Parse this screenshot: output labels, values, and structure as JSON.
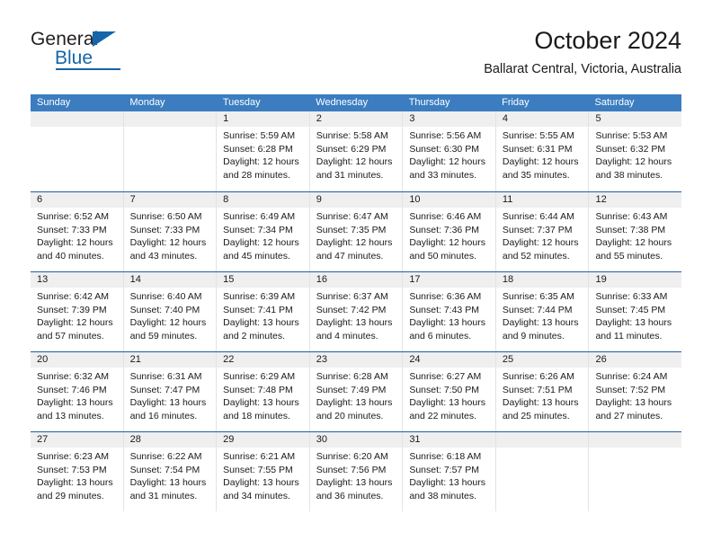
{
  "logo": {
    "word_one": "General",
    "word_two": "Blue",
    "triangle_icon": "triangle-icon",
    "accent_color": "#1565a8"
  },
  "header": {
    "title": "October 2024",
    "subtitle": "Ballarat Central, Victoria, Australia"
  },
  "calendar": {
    "header_bg": "#3b7dc0",
    "header_text_color": "#ffffff",
    "row_divider_color": "#1f5fa6",
    "date_strip_bg": "#efefef",
    "weekdays": [
      "Sunday",
      "Monday",
      "Tuesday",
      "Wednesday",
      "Thursday",
      "Friday",
      "Saturday"
    ],
    "weeks": [
      [
        {
          "date": "",
          "lines": []
        },
        {
          "date": "",
          "lines": []
        },
        {
          "date": "1",
          "lines": [
            "Sunrise: 5:59 AM",
            "Sunset: 6:28 PM",
            "Daylight: 12 hours",
            "and 28 minutes."
          ]
        },
        {
          "date": "2",
          "lines": [
            "Sunrise: 5:58 AM",
            "Sunset: 6:29 PM",
            "Daylight: 12 hours",
            "and 31 minutes."
          ]
        },
        {
          "date": "3",
          "lines": [
            "Sunrise: 5:56 AM",
            "Sunset: 6:30 PM",
            "Daylight: 12 hours",
            "and 33 minutes."
          ]
        },
        {
          "date": "4",
          "lines": [
            "Sunrise: 5:55 AM",
            "Sunset: 6:31 PM",
            "Daylight: 12 hours",
            "and 35 minutes."
          ]
        },
        {
          "date": "5",
          "lines": [
            "Sunrise: 5:53 AM",
            "Sunset: 6:32 PM",
            "Daylight: 12 hours",
            "and 38 minutes."
          ]
        }
      ],
      [
        {
          "date": "6",
          "lines": [
            "Sunrise: 6:52 AM",
            "Sunset: 7:33 PM",
            "Daylight: 12 hours",
            "and 40 minutes."
          ]
        },
        {
          "date": "7",
          "lines": [
            "Sunrise: 6:50 AM",
            "Sunset: 7:33 PM",
            "Daylight: 12 hours",
            "and 43 minutes."
          ]
        },
        {
          "date": "8",
          "lines": [
            "Sunrise: 6:49 AM",
            "Sunset: 7:34 PM",
            "Daylight: 12 hours",
            "and 45 minutes."
          ]
        },
        {
          "date": "9",
          "lines": [
            "Sunrise: 6:47 AM",
            "Sunset: 7:35 PM",
            "Daylight: 12 hours",
            "and 47 minutes."
          ]
        },
        {
          "date": "10",
          "lines": [
            "Sunrise: 6:46 AM",
            "Sunset: 7:36 PM",
            "Daylight: 12 hours",
            "and 50 minutes."
          ]
        },
        {
          "date": "11",
          "lines": [
            "Sunrise: 6:44 AM",
            "Sunset: 7:37 PM",
            "Daylight: 12 hours",
            "and 52 minutes."
          ]
        },
        {
          "date": "12",
          "lines": [
            "Sunrise: 6:43 AM",
            "Sunset: 7:38 PM",
            "Daylight: 12 hours",
            "and 55 minutes."
          ]
        }
      ],
      [
        {
          "date": "13",
          "lines": [
            "Sunrise: 6:42 AM",
            "Sunset: 7:39 PM",
            "Daylight: 12 hours",
            "and 57 minutes."
          ]
        },
        {
          "date": "14",
          "lines": [
            "Sunrise: 6:40 AM",
            "Sunset: 7:40 PM",
            "Daylight: 12 hours",
            "and 59 minutes."
          ]
        },
        {
          "date": "15",
          "lines": [
            "Sunrise: 6:39 AM",
            "Sunset: 7:41 PM",
            "Daylight: 13 hours",
            "and 2 minutes."
          ]
        },
        {
          "date": "16",
          "lines": [
            "Sunrise: 6:37 AM",
            "Sunset: 7:42 PM",
            "Daylight: 13 hours",
            "and 4 minutes."
          ]
        },
        {
          "date": "17",
          "lines": [
            "Sunrise: 6:36 AM",
            "Sunset: 7:43 PM",
            "Daylight: 13 hours",
            "and 6 minutes."
          ]
        },
        {
          "date": "18",
          "lines": [
            "Sunrise: 6:35 AM",
            "Sunset: 7:44 PM",
            "Daylight: 13 hours",
            "and 9 minutes."
          ]
        },
        {
          "date": "19",
          "lines": [
            "Sunrise: 6:33 AM",
            "Sunset: 7:45 PM",
            "Daylight: 13 hours",
            "and 11 minutes."
          ]
        }
      ],
      [
        {
          "date": "20",
          "lines": [
            "Sunrise: 6:32 AM",
            "Sunset: 7:46 PM",
            "Daylight: 13 hours",
            "and 13 minutes."
          ]
        },
        {
          "date": "21",
          "lines": [
            "Sunrise: 6:31 AM",
            "Sunset: 7:47 PM",
            "Daylight: 13 hours",
            "and 16 minutes."
          ]
        },
        {
          "date": "22",
          "lines": [
            "Sunrise: 6:29 AM",
            "Sunset: 7:48 PM",
            "Daylight: 13 hours",
            "and 18 minutes."
          ]
        },
        {
          "date": "23",
          "lines": [
            "Sunrise: 6:28 AM",
            "Sunset: 7:49 PM",
            "Daylight: 13 hours",
            "and 20 minutes."
          ]
        },
        {
          "date": "24",
          "lines": [
            "Sunrise: 6:27 AM",
            "Sunset: 7:50 PM",
            "Daylight: 13 hours",
            "and 22 minutes."
          ]
        },
        {
          "date": "25",
          "lines": [
            "Sunrise: 6:26 AM",
            "Sunset: 7:51 PM",
            "Daylight: 13 hours",
            "and 25 minutes."
          ]
        },
        {
          "date": "26",
          "lines": [
            "Sunrise: 6:24 AM",
            "Sunset: 7:52 PM",
            "Daylight: 13 hours",
            "and 27 minutes."
          ]
        }
      ],
      [
        {
          "date": "27",
          "lines": [
            "Sunrise: 6:23 AM",
            "Sunset: 7:53 PM",
            "Daylight: 13 hours",
            "and 29 minutes."
          ]
        },
        {
          "date": "28",
          "lines": [
            "Sunrise: 6:22 AM",
            "Sunset: 7:54 PM",
            "Daylight: 13 hours",
            "and 31 minutes."
          ]
        },
        {
          "date": "29",
          "lines": [
            "Sunrise: 6:21 AM",
            "Sunset: 7:55 PM",
            "Daylight: 13 hours",
            "and 34 minutes."
          ]
        },
        {
          "date": "30",
          "lines": [
            "Sunrise: 6:20 AM",
            "Sunset: 7:56 PM",
            "Daylight: 13 hours",
            "and 36 minutes."
          ]
        },
        {
          "date": "31",
          "lines": [
            "Sunrise: 6:18 AM",
            "Sunset: 7:57 PM",
            "Daylight: 13 hours",
            "and 38 minutes."
          ]
        },
        {
          "date": "",
          "lines": []
        },
        {
          "date": "",
          "lines": []
        }
      ]
    ]
  }
}
